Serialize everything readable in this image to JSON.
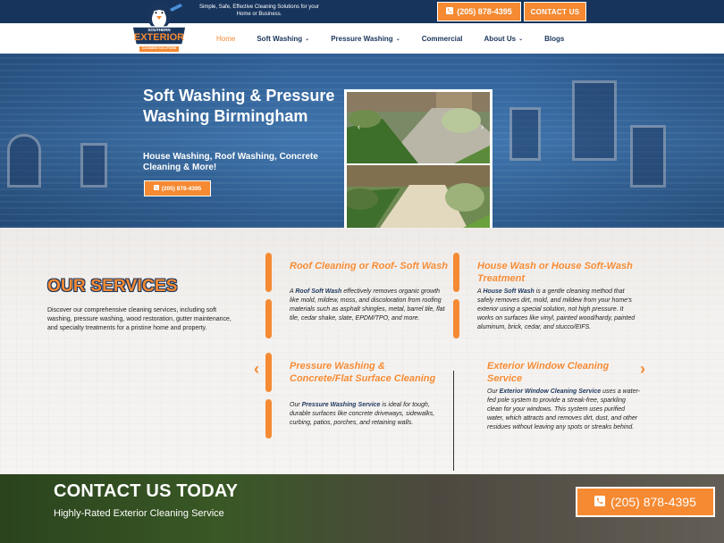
{
  "topbar": {
    "tagline": "Simple, Safe, Effective Cleaning Solutions for your Home or Business.",
    "phone_label": "(205) 878-4395",
    "contact_label": "CONTACT US"
  },
  "logo": {
    "line1": "SOUTHERN",
    "line2": "EXTERIOR",
    "line3": "CLEANING SOLUTIONS"
  },
  "nav": {
    "items": [
      {
        "label": "Home",
        "active": true
      },
      {
        "label": "Soft Washing"
      },
      {
        "label": "Pressure Washing"
      },
      {
        "label": "Commercial"
      },
      {
        "label": "About Us"
      },
      {
        "label": "Blogs"
      }
    ]
  },
  "hero": {
    "title": "Soft Washing & Pressure Washing Birmingham",
    "subtitle": "House Washing, Roof Washing, Concrete Cleaning & More!",
    "button_label": "(205) 878-4395"
  },
  "services": {
    "heading": "OUR SERVICES",
    "intro": "Discover our comprehensive cleaning services, including soft washing, pressure washing, wood restoration, gutter maintenance, and specialty treatments for a pristine home and property.",
    "cards": [
      {
        "title": "Roof Cleaning or Roof- Soft Wash",
        "text_pre": "A ",
        "link": "Roof Soft Wash",
        "text_post": " effectively removes organic growth like mold, mildew, moss, and discoloration from roofing materials such as asphalt shingles, metal, barrel tile, flat tile, cedar shake, slate, EPDM/TPO, and more."
      },
      {
        "title": "House Wash or House Soft-Wash Treatment",
        "text_pre": "A ",
        "link": "House Soft Wash",
        "text_post": " is a gentle cleaning method that safely removes dirt, mold, and mildew from your home's exterior using a special solution, not high pressure. It works on surfaces like vinyl, painted wood/hardy, painted aluminum, brick, cedar, and stucco/EIFS."
      },
      {
        "title": "Pressure Washing & Concrete/Flat Surface Cleaning",
        "text_pre": "Our ",
        "link": "Pressure Washing Service",
        "text_post": " is ideal for tough, durable surfaces like concrete driveways, sidewalks, curbing, patios, porches, and retaining walls."
      },
      {
        "title": "Exterior Window Cleaning Service",
        "text_pre": "Our ",
        "link": "Exterior Window Cleaning Service",
        "text_post": " uses a water-fed pole system to provide a streak-free, sparkling clean for your windows. This system uses purified water, which attracts and removes dirt, dust, and other residues without leaving any spots or streaks behind."
      }
    ]
  },
  "contact": {
    "title": "CONTACT US TODAY",
    "subtitle": "Highly-Rated Exterior Cleaning Service",
    "phone_label": "(205) 878-4395"
  },
  "colors": {
    "accent": "#f58a33",
    "navy": "#17345c",
    "text_dark": "#1b365d"
  },
  "icons": [
    "phone-icon",
    "chevron-down-icon",
    "chevron-left-icon",
    "chevron-right-icon"
  ]
}
